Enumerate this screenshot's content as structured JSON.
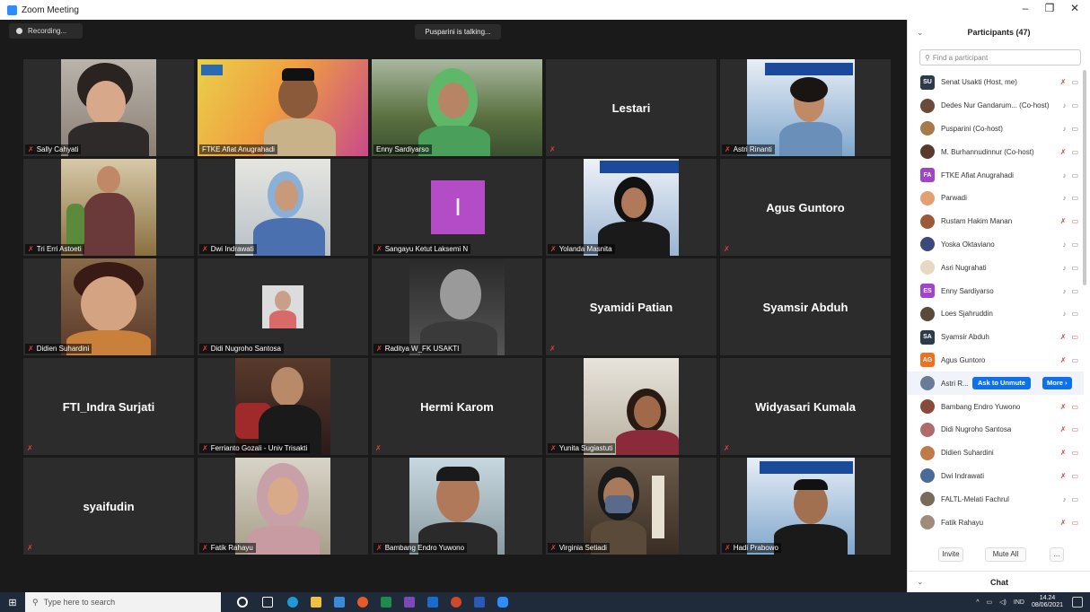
{
  "window": {
    "title": "Zoom Meeting"
  },
  "meeting": {
    "recording_label": "Recording...",
    "talking_label": "Pusparini is talking...",
    "tiles": [
      {
        "label": "Sally Cahyati",
        "video": true,
        "muted": true
      },
      {
        "label": "FTKE Afiat Anugrahadi",
        "video": true,
        "muted": false
      },
      {
        "label": "Enny Sardiyarso",
        "video": true,
        "muted": false
      },
      {
        "name": "Lestari",
        "video": false,
        "muted": true
      },
      {
        "label": "Astri  Rinanti",
        "video": true,
        "muted": true
      },
      {
        "label": "Tri Erri Astoeti",
        "video": true,
        "muted": true
      },
      {
        "label": "Dwi Indrawati",
        "video": true,
        "muted": true
      },
      {
        "label": "Sangayu Ketut Laksemi N",
        "video": true,
        "muted": true,
        "letter": "I"
      },
      {
        "label": "Yolanda Masnita",
        "video": true,
        "muted": true
      },
      {
        "name": "Agus Guntoro",
        "video": false,
        "muted": true
      },
      {
        "label": "Didien Suhardini",
        "video": true,
        "muted": true
      },
      {
        "label": "Didi Nugroho Santosa",
        "video": true,
        "muted": true
      },
      {
        "label": "Raditya W_FK USAKTI",
        "video": true,
        "muted": true
      },
      {
        "name": "Syamidi Patian",
        "video": false,
        "muted": true
      },
      {
        "name": "Syamsir Abduh",
        "video": false,
        "muted": false
      },
      {
        "name": "FTI_Indra Surjati",
        "video": false,
        "muted": true
      },
      {
        "label": "Ferrianto Gozali - Univ Trisakti",
        "video": true,
        "muted": true
      },
      {
        "name": "Hermi Karom",
        "video": false,
        "muted": true
      },
      {
        "label": "Yunita Sugiastuti",
        "video": true,
        "muted": true
      },
      {
        "name": "Widyasari Kumala",
        "video": false,
        "muted": true
      },
      {
        "name": "syaifudin",
        "video": false,
        "muted": true
      },
      {
        "label": "Fatik Rahayu",
        "video": true,
        "muted": true
      },
      {
        "label": "Bambang Endro Yuwono",
        "video": true,
        "muted": true
      },
      {
        "label": "Virginia Setiadi",
        "video": true,
        "muted": true
      },
      {
        "label": "Hadi Prabowo",
        "video": true,
        "muted": true
      }
    ]
  },
  "participants": {
    "title": "Participants (47)",
    "search_placeholder": "Find a participant",
    "rows": [
      {
        "name": "Senat Usakti (Host, me)",
        "initials": "SU",
        "color": "#2d3a4a"
      },
      {
        "name": "Dedes Nur Gandarum... (Co-host)",
        "photo": true,
        "color": "#6b4a3a"
      },
      {
        "name": "Pusparini (Co-host)",
        "photo": true,
        "color": "#a77a4a"
      },
      {
        "name": "M. Burhannudinnur (Co-host)",
        "photo": true,
        "color": "#5a3a2a"
      },
      {
        "name": "FTKE Afiat Anugrahadi",
        "initials": "FA",
        "color": "#a044c8"
      },
      {
        "name": "Parwadi",
        "photo": true,
        "color": "#e4a070"
      },
      {
        "name": "Rustam Hakim Manan",
        "photo": true,
        "color": "#9a5a3a"
      },
      {
        "name": "Yoska Oktaviano",
        "photo": true,
        "color": "#3a4a7a"
      },
      {
        "name": "Asri Nugrahati",
        "photo": true,
        "color": "#e8d8c0"
      },
      {
        "name": "Enny Sardiyarso",
        "initials": "ES",
        "color": "#a044c8"
      },
      {
        "name": "Loes Sjahruddin",
        "photo": true,
        "color": "#5a4a3a"
      },
      {
        "name": "Syamsir Abduh",
        "initials": "SA",
        "color": "#2d3a4a"
      },
      {
        "name": "Agus Guntoro",
        "initials": "AG",
        "color": "#f07020"
      },
      {
        "name": "Astri  R...",
        "photo": true,
        "color": "#6a7a9a",
        "hover": true
      },
      {
        "name": "Bambang Endro Yuwono",
        "photo": true,
        "color": "#8a4a3a"
      },
      {
        "name": "Didi Nugroho Santosa",
        "photo": true,
        "color": "#b06a6a"
      },
      {
        "name": "Didien Suhardini",
        "photo": true,
        "color": "#c07a4a"
      },
      {
        "name": "Dwi Indrawati",
        "photo": true,
        "color": "#4a6a9a"
      },
      {
        "name": "FALTL-Melati Fachrul",
        "photo": true,
        "color": "#7a6a5a"
      },
      {
        "name": "Fatik Rahayu",
        "photo": true,
        "color": "#a08a7a"
      }
    ],
    "ask_to_unmute": "Ask to Unmute",
    "more": "More ›",
    "invite": "Invite",
    "mute_all": "Mute All",
    "ellipsis": "...",
    "chat": "Chat"
  },
  "taskbar": {
    "search_placeholder": "Type here to search",
    "lang": "IND",
    "time": "14.24",
    "date": "08/06/2021"
  }
}
